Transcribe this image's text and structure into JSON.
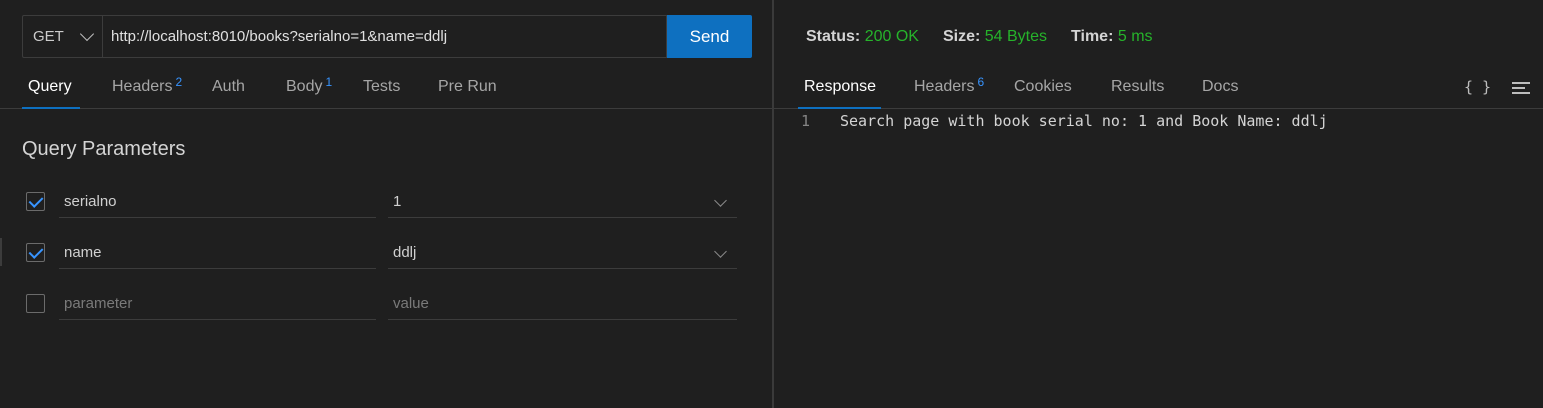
{
  "request": {
    "method": "GET",
    "url": "http://localhost:8010/books?serialno=1&name=ddlj",
    "send_label": "Send"
  },
  "request_tabs": [
    {
      "label": "Query",
      "badge": ""
    },
    {
      "label": "Headers",
      "badge": "2"
    },
    {
      "label": "Auth",
      "badge": ""
    },
    {
      "label": "Body",
      "badge": "1"
    },
    {
      "label": "Tests",
      "badge": ""
    },
    {
      "label": "Pre Run",
      "badge": ""
    }
  ],
  "query": {
    "title": "Query Parameters",
    "params": [
      {
        "name": "serialno",
        "value": "1",
        "checked": true
      },
      {
        "name": "name",
        "value": "ddlj",
        "checked": true
      }
    ],
    "new_row": {
      "name_placeholder": "parameter",
      "value_placeholder": "value"
    }
  },
  "response_meta": {
    "status_label": "Status:",
    "status_value": "200 OK",
    "size_label": "Size:",
    "size_value": "54 Bytes",
    "time_label": "Time:",
    "time_value": "5 ms"
  },
  "response_tabs": [
    {
      "label": "Response",
      "badge": ""
    },
    {
      "label": "Headers",
      "badge": "6"
    },
    {
      "label": "Cookies",
      "badge": ""
    },
    {
      "label": "Results",
      "badge": ""
    },
    {
      "label": "Docs",
      "badge": ""
    }
  ],
  "response_body": {
    "lines": [
      {
        "number": "1",
        "text": "Search page with book serial no: 1 and Book Name: ddlj"
      }
    ]
  },
  "toolbar": {
    "format_label": "{ }",
    "wrap_icon": "wrap-lines-icon"
  },
  "colors": {
    "accent": "#0e70c0",
    "success": "#26b32b",
    "badge": "#3794ff",
    "background": "#1f1f1f"
  }
}
